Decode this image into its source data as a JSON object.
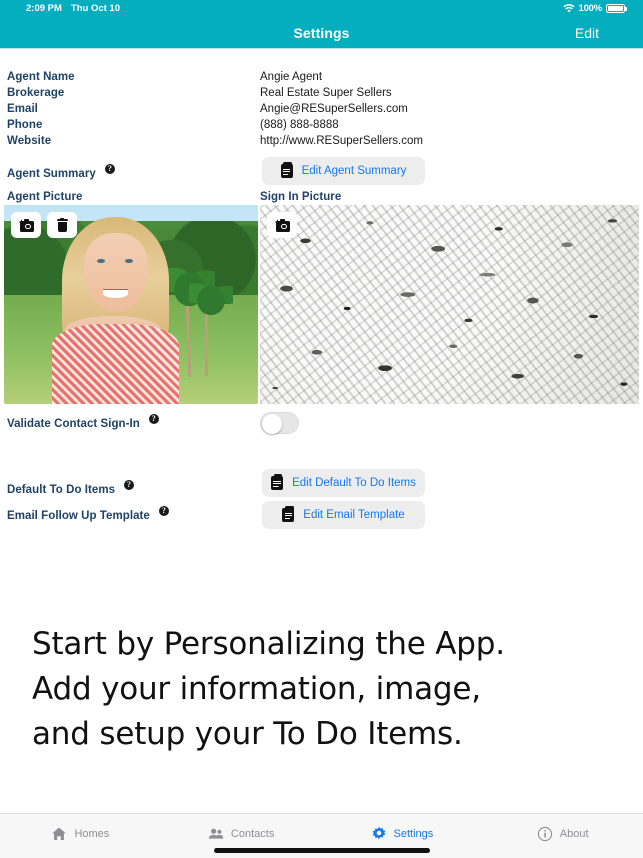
{
  "status_bar": {
    "time": "2:09 PM",
    "date": "Thu Oct 10",
    "battery_percent": "100%",
    "wifi_icon": "wifi-icon",
    "battery_icon": "battery-full-icon"
  },
  "nav": {
    "title": "Settings",
    "edit_label": "Edit"
  },
  "colors": {
    "nav_teal": "#04AEBE",
    "label_navy": "#1F4266",
    "link_blue": "#1478F0",
    "button_gray": "#EDEDED",
    "tab_inactive": "#8E8E93"
  },
  "form": {
    "labels": {
      "agent_name": "Agent Name",
      "brokerage": "Brokerage",
      "email": "Email",
      "phone": "Phone",
      "website": "Website",
      "agent_summary": "Agent Summary",
      "agent_picture": "Agent Picture",
      "sign_in_picture": "Sign In Picture",
      "validate_contact_signin": "Validate Contact Sign-In",
      "default_todo_items": "Default To Do Items",
      "email_follow_up_template": "Email Follow Up Template"
    },
    "values": {
      "agent_name": "Angie Agent",
      "brokerage": "Real Estate Super Sellers",
      "email": "Angie@RESuperSellers.com",
      "phone": "(888) 888-8888",
      "website": "http://www.RESuperSellers.com"
    },
    "help_glyph": "?",
    "buttons": {
      "edit_agent_summary": "Edit Agent Summary",
      "edit_default_todo": "Edit Default To Do Items",
      "edit_email_template": "Edit Email Template"
    },
    "toggle": {
      "name": "validate-contact-signin-toggle",
      "state": "off"
    },
    "pictures": {
      "agent": {
        "camera_icon": "camera-add-icon",
        "delete_icon": "trash-icon",
        "description": "Portrait photo of a blonde woman outdoors with trees, grass and palm trees"
      },
      "sign_in": {
        "camera_icon": "camera-add-icon",
        "description": "White and gray speckled granite texture"
      }
    }
  },
  "headline": {
    "line1": "Start by Personalizing the App.",
    "line2": "Add your information, image,",
    "line3": "and setup your To Do Items."
  },
  "tabbar": {
    "tabs": [
      {
        "label": "Homes",
        "icon": "home-icon",
        "active": false
      },
      {
        "label": "Contacts",
        "icon": "contacts-icon",
        "active": false
      },
      {
        "label": "Settings",
        "icon": "gear-icon",
        "active": true
      },
      {
        "label": "About",
        "icon": "info-icon",
        "active": false
      }
    ]
  }
}
